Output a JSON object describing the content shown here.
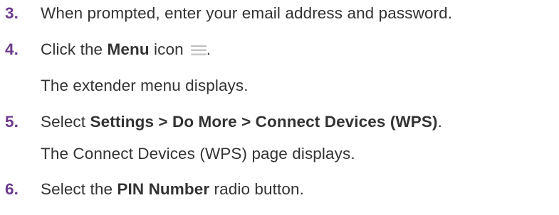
{
  "steps": [
    {
      "number": "3.",
      "text": "When prompted, enter your email address and password."
    },
    {
      "number": "4.",
      "pre": "Click the ",
      "bold": "Menu",
      "post": " icon",
      "icon": "hamburger-menu-icon",
      "trail": ".",
      "followup": "The extender menu displays."
    },
    {
      "number": "5.",
      "pre": "Select ",
      "bold1": "Settings",
      "sep1": " > ",
      "bold2": "Do More",
      "sep2": " > ",
      "bold3": "Connect Devices (WPS)",
      "trail": ".",
      "followup": "The Connect Devices (WPS) page displays."
    },
    {
      "number": "6.",
      "pre": "Select the ",
      "bold": "PIN Number",
      "post": " radio button."
    }
  ],
  "colors": {
    "step_number": "#6b3a8c",
    "body_text": "#333333"
  }
}
